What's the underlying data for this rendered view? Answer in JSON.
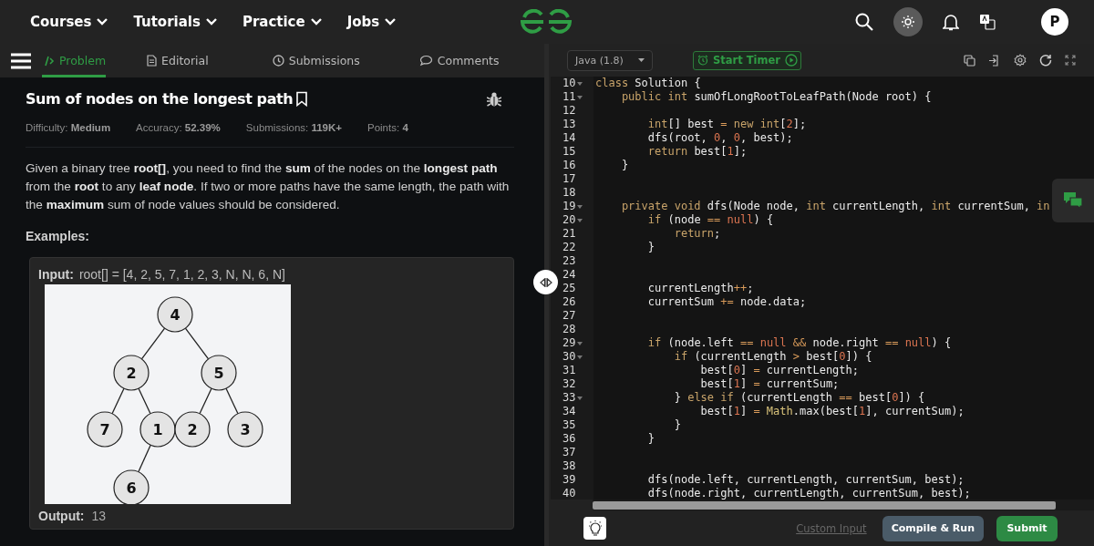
{
  "nav": {
    "menus": [
      "Courses",
      "Tutorials",
      "Practice",
      "Jobs"
    ],
    "avatar": "P"
  },
  "tabs": [
    {
      "label": "Problem",
      "selected": true
    },
    {
      "label": "Editorial",
      "selected": false
    },
    {
      "label": "Submissions",
      "selected": false
    },
    {
      "label": "Comments",
      "selected": false
    }
  ],
  "problem": {
    "title": "Sum of nodes on the longest path",
    "meta": [
      {
        "label": "Difficulty:",
        "value": "Medium"
      },
      {
        "label": "Accuracy:",
        "value": "52.39%"
      },
      {
        "label": "Submissions:",
        "value": "119K+"
      },
      {
        "label": "Points:",
        "value": "4"
      }
    ],
    "description": "Given a binary tree **root[]**, you need to find the **sum** of the nodes on the **longest path** from the **root** to any **leaf node**. If two or more paths have the same length, the path with the **maximum** sum of node values should be considered.",
    "examples_heading": "Examples:",
    "example": {
      "input_label": "Input:",
      "input": "root[] = [4, 2, 5, 7, 1, 2, 3, N, N, 6, N]",
      "tree": {
        "value": "4",
        "children": [
          {
            "value": "2",
            "children": [
              {
                "value": "7"
              },
              {
                "value": "1",
                "children": [
                  {
                    "value": "6"
                  }
                ]
              }
            ]
          },
          {
            "value": "5",
            "children": [
              {
                "value": "2"
              },
              {
                "value": "3"
              }
            ]
          }
        ]
      },
      "output_label": "Output:",
      "output": "13"
    }
  },
  "editor": {
    "language": "Java (1.8)",
    "timer": "Start Timer",
    "lines": [
      {
        "number": "10",
        "fold": true,
        "segments": [
          {
            "kind": "kw",
            "text": "class "
          },
          {
            "kind": "plain",
            "text": "Solution {"
          }
        ]
      },
      {
        "number": "11",
        "fold": true,
        "segments": [
          {
            "kind": "kw",
            "text": "    public int "
          },
          {
            "kind": "plain",
            "text": "sumOfLongRootToLeafPath(Node root) {"
          }
        ]
      },
      {
        "number": "12",
        "fold": false
      },
      {
        "number": "13",
        "fold": false,
        "segments": [
          {
            "kind": "kw",
            "text": "        int"
          },
          {
            "kind": "plain",
            "text": "[] best "
          },
          {
            "kind": "op",
            "text": "= "
          },
          {
            "kind": "kw",
            "text": "new int"
          },
          {
            "kind": "plain",
            "text": "["
          },
          {
            "kind": "num",
            "text": "2"
          },
          {
            "kind": "plain",
            "text": "];"
          }
        ]
      },
      {
        "number": "14",
        "fold": false,
        "segments": [
          {
            "kind": "plain",
            "text": "        dfs(root, "
          },
          {
            "kind": "num",
            "text": "0"
          },
          {
            "kind": "plain",
            "text": ", "
          },
          {
            "kind": "num",
            "text": "0"
          },
          {
            "kind": "plain",
            "text": ", best);"
          }
        ]
      },
      {
        "number": "15",
        "fold": false,
        "segments": [
          {
            "kind": "kw",
            "text": "        return"
          },
          {
            "kind": "plain",
            "text": " best["
          },
          {
            "kind": "num",
            "text": "1"
          },
          {
            "kind": "plain",
            "text": "];"
          }
        ]
      },
      {
        "number": "16",
        "fold": false,
        "segments": [
          {
            "kind": "plain",
            "text": "    }"
          }
        ]
      },
      {
        "number": "17",
        "fold": false
      },
      {
        "number": "18",
        "fold": false
      },
      {
        "number": "19",
        "fold": true,
        "segments": [
          {
            "kind": "kw",
            "text": "    private void "
          },
          {
            "kind": "plain",
            "text": "dfs(Node node, "
          },
          {
            "kind": "kw",
            "text": "int "
          },
          {
            "kind": "plain",
            "text": "currentLength, "
          },
          {
            "kind": "kw",
            "text": "int "
          },
          {
            "kind": "plain",
            "text": "currentSum, "
          },
          {
            "kind": "kw",
            "text": "in"
          }
        ]
      },
      {
        "number": "20",
        "fold": true,
        "segments": [
          {
            "kind": "kw",
            "text": "        if "
          },
          {
            "kind": "plain",
            "text": "(node "
          },
          {
            "kind": "op",
            "text": "== "
          },
          {
            "kind": "num",
            "text": "null"
          },
          {
            "kind": "plain",
            "text": ") {"
          }
        ]
      },
      {
        "number": "21",
        "fold": false,
        "segments": [
          {
            "kind": "kw",
            "text": "            return"
          },
          {
            "kind": "plain",
            "text": ";"
          }
        ]
      },
      {
        "number": "22",
        "fold": false,
        "segments": [
          {
            "kind": "plain",
            "text": "        }"
          }
        ]
      },
      {
        "number": "23",
        "fold": false
      },
      {
        "number": "24",
        "fold": false
      },
      {
        "number": "25",
        "fold": false,
        "segments": [
          {
            "kind": "plain",
            "text": "        currentLength"
          },
          {
            "kind": "op",
            "text": "++"
          },
          {
            "kind": "plain",
            "text": ";"
          }
        ]
      },
      {
        "number": "26",
        "fold": false,
        "segments": [
          {
            "kind": "plain",
            "text": "        currentSum "
          },
          {
            "kind": "op",
            "text": "+="
          },
          {
            "kind": "plain",
            "text": " node.data;"
          }
        ]
      },
      {
        "number": "27",
        "fold": false
      },
      {
        "number": "28",
        "fold": false
      },
      {
        "number": "29",
        "fold": true,
        "segments": [
          {
            "kind": "kw",
            "text": "        if "
          },
          {
            "kind": "plain",
            "text": "(node.left "
          },
          {
            "kind": "op",
            "text": "== "
          },
          {
            "kind": "num",
            "text": "null "
          },
          {
            "kind": "op",
            "text": "&&"
          },
          {
            "kind": "plain",
            "text": " node.right "
          },
          {
            "kind": "op",
            "text": "== "
          },
          {
            "kind": "num",
            "text": "null"
          },
          {
            "kind": "plain",
            "text": ") {"
          }
        ]
      },
      {
        "number": "30",
        "fold": true,
        "segments": [
          {
            "kind": "kw",
            "text": "            if "
          },
          {
            "kind": "plain",
            "text": "(currentLength "
          },
          {
            "kind": "op",
            "text": ">"
          },
          {
            "kind": "plain",
            "text": " best["
          },
          {
            "kind": "num",
            "text": "0"
          },
          {
            "kind": "plain",
            "text": "]) {"
          }
        ]
      },
      {
        "number": "31",
        "fold": false,
        "segments": [
          {
            "kind": "plain",
            "text": "                best["
          },
          {
            "kind": "num",
            "text": "0"
          },
          {
            "kind": "plain",
            "text": "] "
          },
          {
            "kind": "op",
            "text": "="
          },
          {
            "kind": "plain",
            "text": " currentLength;"
          }
        ]
      },
      {
        "number": "32",
        "fold": false,
        "segments": [
          {
            "kind": "plain",
            "text": "                best["
          },
          {
            "kind": "num",
            "text": "1"
          },
          {
            "kind": "plain",
            "text": "] "
          },
          {
            "kind": "op",
            "text": "="
          },
          {
            "kind": "plain",
            "text": " currentSum;"
          }
        ]
      },
      {
        "number": "33",
        "fold": true,
        "segments": [
          {
            "kind": "plain",
            "text": "            } "
          },
          {
            "kind": "kw",
            "text": "else if "
          },
          {
            "kind": "plain",
            "text": "(currentLength "
          },
          {
            "kind": "op",
            "text": "=="
          },
          {
            "kind": "plain",
            "text": " best["
          },
          {
            "kind": "num",
            "text": "0"
          },
          {
            "kind": "plain",
            "text": "]) {"
          }
        ]
      },
      {
        "number": "34",
        "fold": false,
        "segments": [
          {
            "kind": "plain",
            "text": "                best["
          },
          {
            "kind": "num",
            "text": "1"
          },
          {
            "kind": "plain",
            "text": "] "
          },
          {
            "kind": "op",
            "text": "= "
          },
          {
            "kind": "cls",
            "text": "Math"
          },
          {
            "kind": "plain",
            "text": ".max(best["
          },
          {
            "kind": "num",
            "text": "1"
          },
          {
            "kind": "plain",
            "text": "], currentSum);"
          }
        ]
      },
      {
        "number": "35",
        "fold": false,
        "segments": [
          {
            "kind": "plain",
            "text": "            }"
          }
        ]
      },
      {
        "number": "36",
        "fold": false,
        "segments": [
          {
            "kind": "plain",
            "text": "        }"
          }
        ]
      },
      {
        "number": "37",
        "fold": false
      },
      {
        "number": "38",
        "fold": false
      },
      {
        "number": "39",
        "fold": false,
        "segments": [
          {
            "kind": "plain",
            "text": "        dfs(node.left, currentLength, currentSum, best);"
          }
        ]
      },
      {
        "number": "40",
        "fold": false,
        "segments": [
          {
            "kind": "plain",
            "text": "        dfs(node.right, currentLength, currentSum, best);"
          }
        ]
      }
    ]
  },
  "footer": {
    "custom_input": "Custom Input",
    "compile": "Compile & Run",
    "submit": "Submit"
  }
}
